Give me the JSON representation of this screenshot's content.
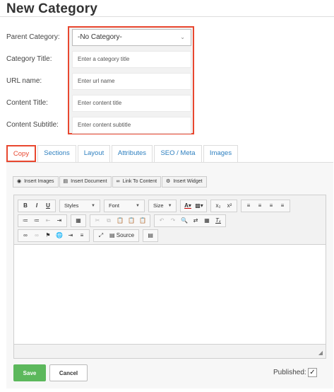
{
  "page_title": "New Category",
  "form": {
    "parent_label": "Parent Category:",
    "parent_value": "-No Category-",
    "title_label": "Category Title:",
    "title_placeholder": "Enter a category title",
    "url_label": "URL name:",
    "url_placeholder": "Enter url name",
    "content_title_label": "Content Title:",
    "content_title_placeholder": "Enter content title",
    "content_subtitle_label": "Content Subtitle:",
    "content_subtitle_placeholder": "Enter content subtitle"
  },
  "tabs": [
    {
      "label": "Copy",
      "active": true
    },
    {
      "label": "Sections"
    },
    {
      "label": "Layout"
    },
    {
      "label": "Attributes"
    },
    {
      "label": "SEO / Meta"
    },
    {
      "label": "Images"
    }
  ],
  "insert_bar": [
    {
      "label": "Insert Images",
      "icon": "camera-icon"
    },
    {
      "label": "Insert Document",
      "icon": "document-icon"
    },
    {
      "label": "Link To Content",
      "icon": "link-icon"
    },
    {
      "label": "Insert Widget",
      "icon": "gear-icon"
    }
  ],
  "toolbar": {
    "bold": "B",
    "italic": "I",
    "underline": "U",
    "styles": "Styles",
    "font": "Font",
    "size": "Size",
    "source": "Source"
  },
  "footer": {
    "save": "Save",
    "cancel": "Cancel",
    "published": "Published:",
    "published_checked": true
  },
  "colors": {
    "highlight": "#e8472f",
    "tab_link": "#2f80c0",
    "save_green": "#5cb85c"
  }
}
